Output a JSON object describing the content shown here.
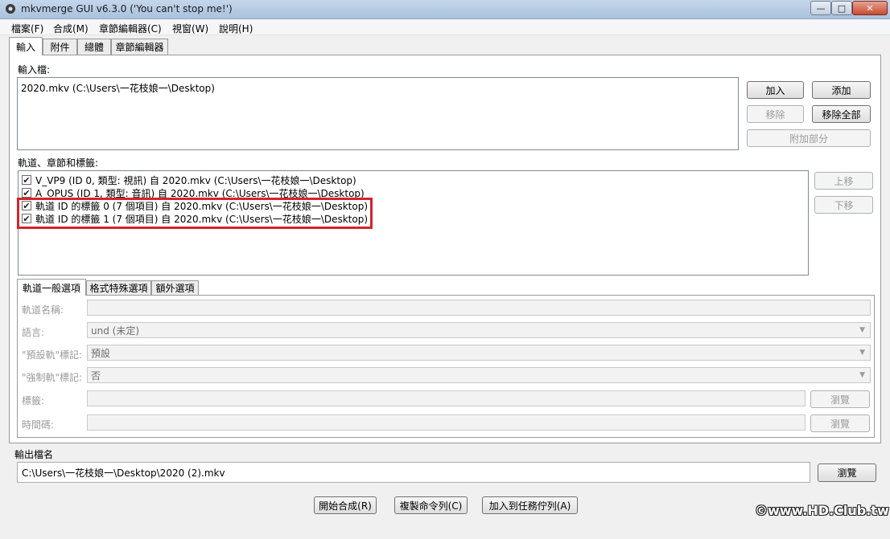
{
  "window": {
    "title": "mkvmerge GUI v6.3.0 ('You can't stop me!')",
    "minimize_glyph": "—",
    "maximize_glyph": "□",
    "close_glyph": "✕"
  },
  "menu": [
    "檔案(F)",
    "合成(M)",
    "章節編輯器(C)",
    "視窗(W)",
    "說明(H)"
  ],
  "tabs": [
    "輸入",
    "附件",
    "總體",
    "章節編輯器"
  ],
  "input": {
    "label": "輸入檔:",
    "files": [
      "2020.mkv (C:\\Users\\一花枝娘一\\Desktop)"
    ],
    "buttons": {
      "add": "加入",
      "append": "添加",
      "remove": "移除",
      "remove_all": "移除全部",
      "add_parts": "附加部分"
    }
  },
  "tracks": {
    "label": "軌道、章節和標籤:",
    "items": [
      {
        "text": "V_VP9 (ID 0, 類型: 視訊) 自 2020.mkv (C:\\Users\\一花枝娘一\\Desktop)",
        "checked": true
      },
      {
        "text": "A_OPUS (ID 1, 類型: 音訊) 自 2020.mkv (C:\\Users\\一花枝娘一\\Desktop)",
        "checked": true
      },
      {
        "text": "軌道 ID 的標籤 0 (7 個項目) 自 2020.mkv (C:\\Users\\一花枝娘一\\Desktop)",
        "checked": true
      },
      {
        "text": "軌道 ID 的標籤 1 (7 個項目) 自 2020.mkv (C:\\Users\\一花枝娘一\\Desktop)",
        "checked": true
      }
    ],
    "check_glyph": "✔",
    "buttons": {
      "up": "上移",
      "down": "下移"
    }
  },
  "subtabs": [
    "軌道一般選項",
    "格式特殊選項",
    "額外選項"
  ],
  "options": {
    "track_name_label": "軌道名稱:",
    "track_name_value": "",
    "language_label": "語言:",
    "language_value": "und (未定)",
    "default_label": "\"預設軌\"標記:",
    "default_value": "預設",
    "forced_label": "\"強制軌\"標記:",
    "forced_value": "否",
    "tags_label": "標籤:",
    "tags_value": "",
    "timecodes_label": "時間碼:",
    "timecodes_value": "",
    "browse": "瀏覽",
    "dropdown_glyph": "▼"
  },
  "output": {
    "label": "輸出檔名",
    "value": "C:\\Users\\一花枝娘一\\Desktop\\2020 (2).mkv",
    "browse": "瀏覽"
  },
  "bottom_buttons": {
    "start": "開始合成(R)",
    "copy_cmd": "複製命令列(C)",
    "add_queue": "加入到任務佇列(A)"
  },
  "watermark": "©www.HD.Club.tw",
  "colors": {
    "highlight": "#d4242b",
    "title_bar": "#b7cce3"
  }
}
